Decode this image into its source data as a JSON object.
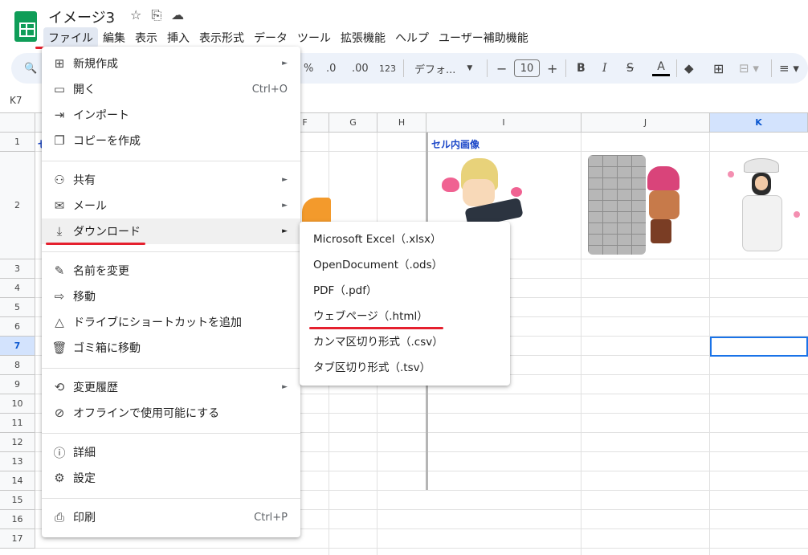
{
  "doc": {
    "title": "イメージ3"
  },
  "menubar": [
    "ファイル",
    "編集",
    "表示",
    "挿入",
    "表示形式",
    "データ",
    "ツール",
    "拡張機能",
    "ヘルプ",
    "ユーザー補助機能"
  ],
  "toolbar": {
    "percent": "%",
    "dec_less": ".0",
    "dec_more": ".00",
    "num_format": "123",
    "font": "デフォ...",
    "font_size": "10",
    "minus": "−",
    "plus": "+",
    "bold": "B",
    "italic": "I",
    "strike": "S",
    "text_color": "A"
  },
  "namebox": "K7",
  "columns": [
    "F",
    "G",
    "H",
    "I",
    "J",
    "K"
  ],
  "rows": [
    "1",
    "2",
    "3",
    "4",
    "5",
    "6",
    "7",
    "8",
    "9",
    "10",
    "11",
    "12",
    "13",
    "14",
    "15",
    "16",
    "17"
  ],
  "cells": {
    "i1": "セル内画像",
    "b1": "セ"
  },
  "file_menu": {
    "items": [
      {
        "icon": "new-icon",
        "label": "新規作成",
        "arrow": "►"
      },
      {
        "icon": "folder-icon",
        "label": "開く",
        "shortcut": "Ctrl+O"
      },
      {
        "icon": "import-icon",
        "label": "インポート"
      },
      {
        "icon": "copy-icon",
        "label": "コピーを作成"
      },
      {
        "icon": "share-icon",
        "label": "共有",
        "arrow": "►"
      },
      {
        "icon": "mail-icon",
        "label": "メール",
        "arrow": "►"
      },
      {
        "icon": "download-icon",
        "label": "ダウンロード",
        "arrow": "►"
      },
      {
        "icon": "rename-icon",
        "label": "名前を変更"
      },
      {
        "icon": "move-icon",
        "label": "移動"
      },
      {
        "icon": "drive-shortcut-icon",
        "label": "ドライブにショートカットを追加"
      },
      {
        "icon": "trash-icon",
        "label": "ゴミ箱に移動"
      },
      {
        "icon": "history-icon",
        "label": "変更履歴",
        "arrow": "►"
      },
      {
        "icon": "offline-icon",
        "label": "オフラインで使用可能にする"
      },
      {
        "icon": "info-icon",
        "label": "詳細"
      },
      {
        "icon": "settings-icon",
        "label": "設定"
      },
      {
        "icon": "print-icon",
        "label": "印刷",
        "shortcut": "Ctrl+P"
      }
    ]
  },
  "download_menu": {
    "items": [
      "Microsoft Excel（.xlsx）",
      "OpenDocument（.ods）",
      "PDF（.pdf）",
      "ウェブページ（.html）",
      "カンマ区切り形式（.csv）",
      "タブ区切り形式（.tsv）"
    ]
  },
  "colors": {
    "accent": "#1a73e8",
    "highlight_red": "#e5202e",
    "sheets_green": "#0f9d58",
    "link_blue": "#1a46c8"
  }
}
